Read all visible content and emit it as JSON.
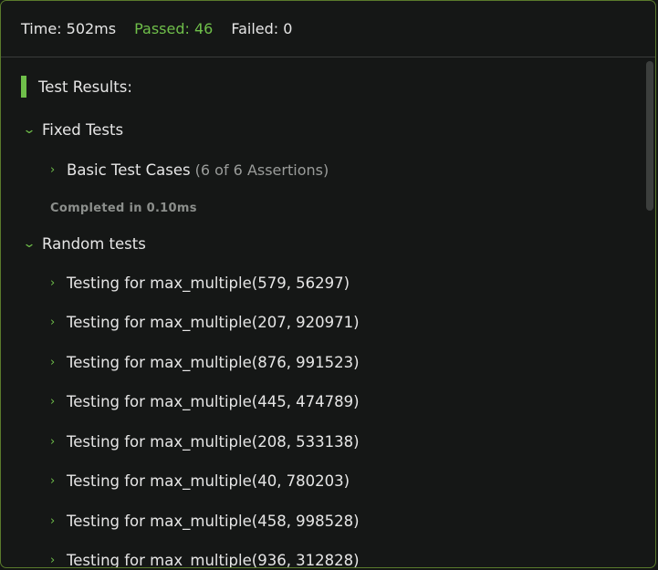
{
  "header": {
    "time": "Time: 502ms",
    "passed": "Passed: 46",
    "failed": "Failed: 0"
  },
  "results_title": "Test Results:",
  "groups": [
    {
      "label": "Fixed Tests",
      "children": [
        {
          "label": "Basic Test Cases",
          "assertions": "(6 of 6 Assertions)"
        }
      ],
      "completed": "Completed in 0.10ms"
    },
    {
      "label": "Random tests",
      "children": [
        {
          "label": "Testing for max_multiple(579, 56297)"
        },
        {
          "label": "Testing for max_multiple(207, 920971)"
        },
        {
          "label": "Testing for max_multiple(876, 991523)"
        },
        {
          "label": "Testing for max_multiple(445, 474789)"
        },
        {
          "label": "Testing for max_multiple(208, 533138)"
        },
        {
          "label": "Testing for max_multiple(40, 780203)"
        },
        {
          "label": "Testing for max_multiple(458, 998528)"
        },
        {
          "label": "Testing for max_multiple(936, 312828)"
        }
      ]
    }
  ],
  "colors": {
    "accent": "#6fbf4a",
    "background": "#151716",
    "border": "#5a7a2c"
  }
}
